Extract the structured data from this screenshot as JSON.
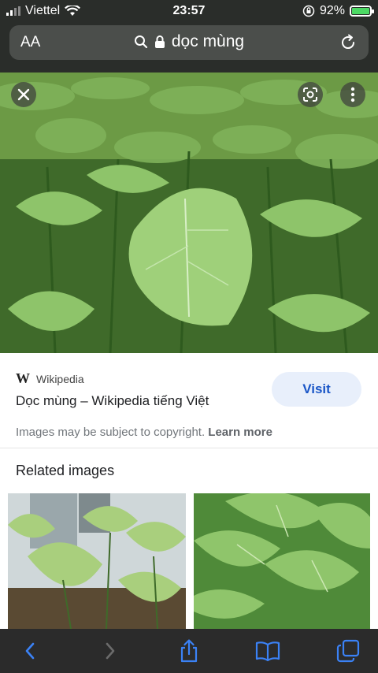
{
  "status_bar": {
    "carrier": "Viettel",
    "time": "23:57",
    "battery_percent": "92%",
    "icons": [
      "signal-icon",
      "wifi-icon",
      "orientation-lock-icon",
      "battery-charging-icon"
    ]
  },
  "address_bar": {
    "text_size_label": "AA",
    "url_text": "dọc mùng",
    "icons": [
      "search-icon",
      "lock-icon",
      "reload-icon"
    ]
  },
  "image_viewer": {
    "icons": [
      "close-icon",
      "lens-icon",
      "more-vert-icon"
    ]
  },
  "result": {
    "source_name": "Wikipedia",
    "title": "Dọc mùng – Wikipedia tiếng Việt",
    "visit_label": "Visit",
    "copyright_text": "Images may be subject to copyright.",
    "learn_more_label": "Learn more"
  },
  "related": {
    "heading": "Related images"
  },
  "toolbar": {
    "icons": [
      "back-icon",
      "forward-icon",
      "share-icon",
      "bookmarks-icon",
      "tabs-icon"
    ]
  },
  "colors": {
    "chrome_bg": "#2a2d2a",
    "url_bg": "#4b4e4b",
    "visit_bg": "#e8effb",
    "visit_text": "#1a56c7",
    "toolbar_icon": "#3b82f6"
  }
}
